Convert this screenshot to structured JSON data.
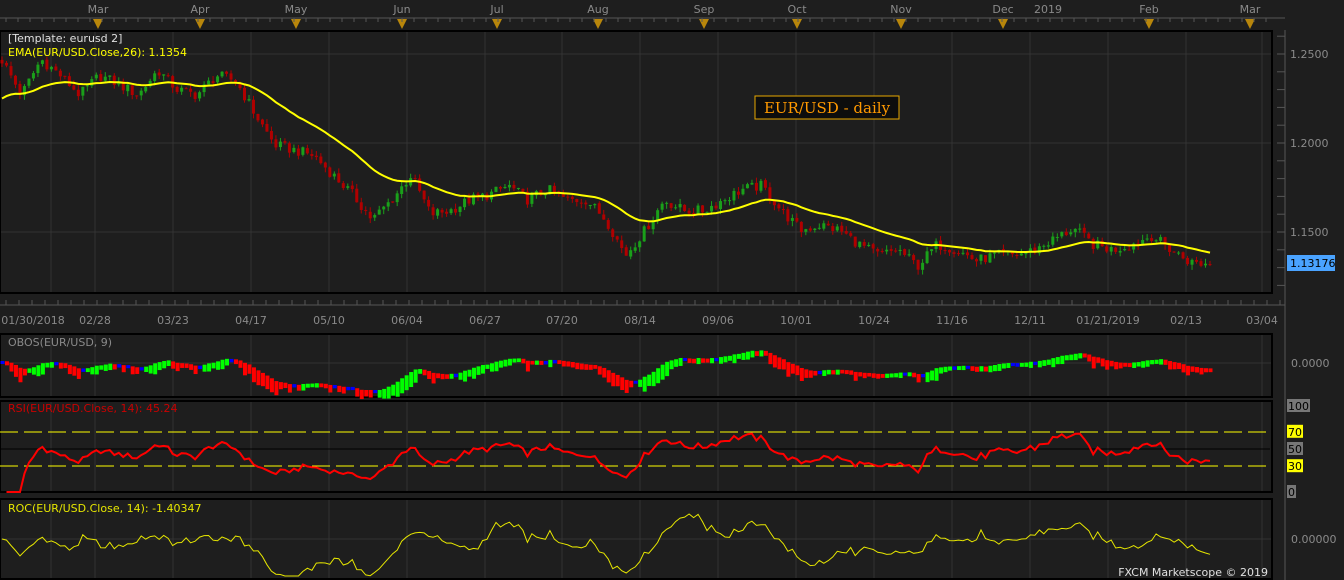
{
  "chart_data": {
    "type": "candlestick",
    "title": "EUR/USD - daily",
    "template_label": "[Template: eurusd 2]",
    "ema_label": "EMA(EUR/USD.Close,26): 1.1354",
    "last_price": "1.13176",
    "month_labels": [
      "Mar",
      "Apr",
      "May",
      "Jun",
      "Jul",
      "Aug",
      "Sep",
      "Oct",
      "Nov",
      "Dec",
      "2019",
      "Feb",
      "Mar"
    ],
    "date_labels": [
      "01/30/2018",
      "02/28",
      "03/23",
      "04/17",
      "05/10",
      "06/04",
      "06/27",
      "07/20",
      "08/14",
      "09/06",
      "10/01",
      "10/24",
      "11/16",
      "12/11",
      "01/21/2019",
      "02/13",
      "03/04"
    ],
    "price_ticks": [
      "1.2500",
      "1.2000",
      "1.1500"
    ],
    "ylim": [
      1.115,
      1.265
    ],
    "closes_sampled": [
      1.2466,
      1.227,
      1.247,
      1.238,
      1.227,
      1.238,
      1.233,
      1.227,
      1.241,
      1.23,
      1.227,
      1.238,
      1.235,
      1.216,
      1.199,
      1.196,
      1.193,
      1.182,
      1.171,
      1.157,
      1.168,
      1.182,
      1.16,
      1.162,
      1.168,
      1.171,
      1.176,
      1.168,
      1.174,
      1.168,
      1.168,
      1.157,
      1.137,
      1.151,
      1.168,
      1.162,
      1.162,
      1.168,
      1.174,
      1.176,
      1.162,
      1.151,
      1.154,
      1.151,
      1.143,
      1.137,
      1.14,
      1.131,
      1.143,
      1.14,
      1.134,
      1.137,
      1.137,
      1.14,
      1.146,
      1.152,
      1.143,
      1.14,
      1.143,
      1.148,
      1.14,
      1.133,
      1.13176
    ],
    "colors": {
      "up": "#1aa01a",
      "down": "#b00000",
      "ema": "#ffff00",
      "background": "#1e1e1e",
      "grid": "#333333",
      "title": "#ff9900",
      "last_price_bg": "#4aa3ff"
    },
    "obos": {
      "label": "OBOS(EUR/USD, 9)",
      "zero_tick": "0.0000"
    },
    "rsi": {
      "label": "RSI(EUR/USD.Close, 14): 45.24",
      "levels": [
        "100",
        "70",
        "50",
        "30",
        "0"
      ],
      "ylim": [
        0,
        100
      ]
    },
    "roc": {
      "label": "ROC(EUR/USD.Close, 14): -1.40347",
      "zero_tick": "0.00000"
    },
    "footer": "FXCM Marketscope © 2019"
  }
}
